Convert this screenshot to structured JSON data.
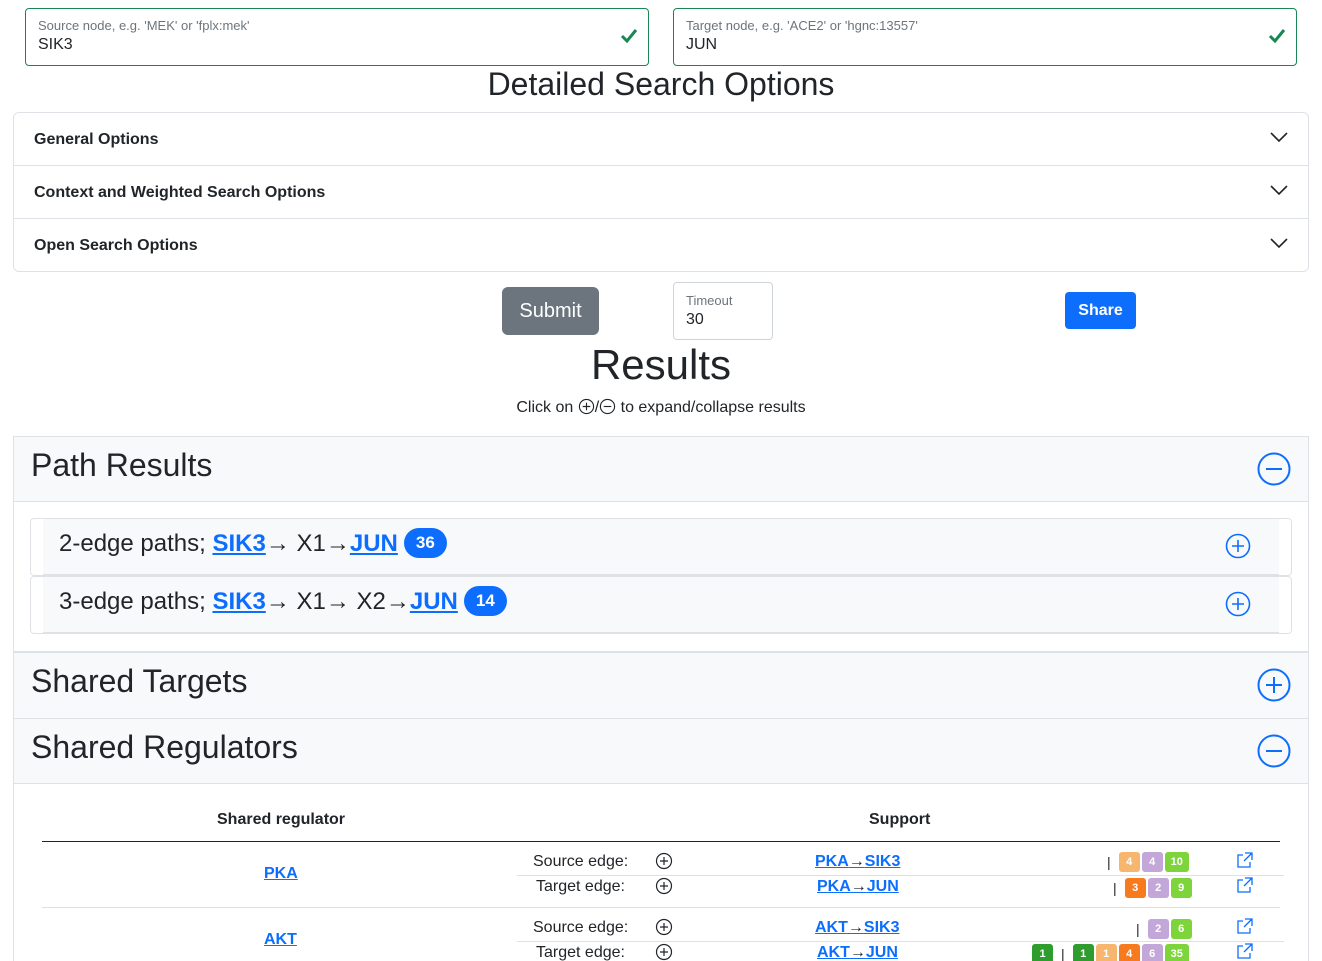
{
  "source": {
    "placeholder": "Source node, e.g. 'MEK' or 'fplx:mek'",
    "value": "SIK3"
  },
  "target": {
    "placeholder": "Target node, e.g. 'ACE2' or 'hgnc:13557'",
    "value": "JUN"
  },
  "detailed_title": "Detailed Search Options",
  "options": [
    "General Options",
    "Context and Weighted Search Options",
    "Open Search Options"
  ],
  "submit_label": "Submit",
  "timeout": {
    "label": "Timeout",
    "value": "30"
  },
  "share_label": "Share",
  "results_title": "Results",
  "results_hint": {
    "before": "Click on ",
    "after": " to expand/collapse results"
  },
  "path_results": {
    "title": "Path Results",
    "two_edge": {
      "prefix": "2-edge paths; ",
      "source": "SIK3",
      "middle": "→ X1→",
      "target": "JUN",
      "count": "36"
    },
    "three_edge": {
      "prefix": "3-edge paths; ",
      "source": "SIK3",
      "middle": "→ X1→ X2→",
      "target": "JUN",
      "count": "14"
    }
  },
  "shared_targets": {
    "title": "Shared Targets"
  },
  "shared_regulators": {
    "title": "Shared Regulators",
    "col_regulator": "Shared regulator",
    "col_support": "Support",
    "source_edge_label": "Source edge:",
    "target_edge_label": "Target edge:",
    "rows": [
      {
        "name": "PKA",
        "source_edge": {
          "from": "PKA",
          "arrow": "→",
          "to": "SIK3",
          "badges": [
            {
              "v": "4",
              "c": "#f7b66d"
            },
            {
              "v": "4",
              "c": "#c3a7d9"
            },
            {
              "v": "10",
              "c": "#7ed53b"
            }
          ]
        },
        "target_edge": {
          "from": "PKA",
          "arrow": "→",
          "to": "JUN",
          "badges": [
            {
              "v": "3",
              "c": "#f77a1e"
            },
            {
              "v": "2",
              "c": "#c3a7d9"
            },
            {
              "v": "9",
              "c": "#7ed53b"
            }
          ]
        }
      },
      {
        "name": "AKT",
        "source_edge": {
          "from": "AKT",
          "arrow": "→",
          "to": "SIK3",
          "badges": [
            {
              "v": "2",
              "c": "#c3a7d9"
            },
            {
              "v": "6",
              "c": "#7ed53b"
            }
          ]
        },
        "target_edge": {
          "from": "AKT",
          "arrow": "→",
          "to": "JUN",
          "pre_badge": {
            "v": "1",
            "c": "#2e9d2e"
          },
          "badges": [
            {
              "v": "1",
              "c": "#2e9d2e"
            },
            {
              "v": "1",
              "c": "#f7b66d"
            },
            {
              "v": "4",
              "c": "#f77a1e"
            },
            {
              "v": "6",
              "c": "#c3a7d9"
            },
            {
              "v": "35",
              "c": "#7ed53b"
            }
          ]
        }
      }
    ]
  }
}
